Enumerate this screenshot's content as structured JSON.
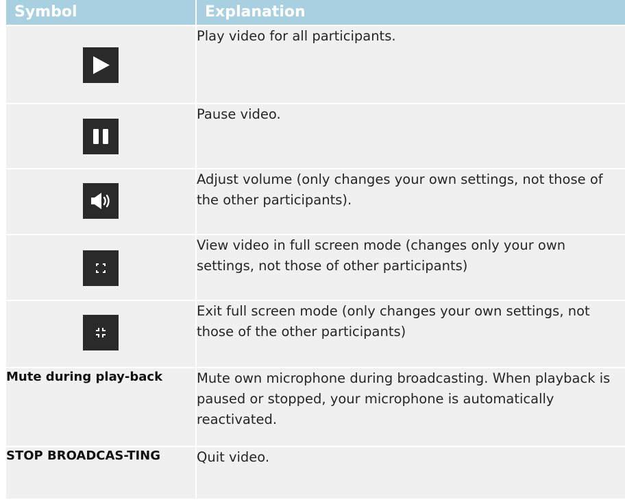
{
  "table": {
    "headers": {
      "symbol": "Symbol",
      "explanation": "Explanation"
    },
    "rows": [
      {
        "symbol_icon": "play-icon",
        "explanation": "Play video for all participants."
      },
      {
        "symbol_icon": "pause-icon",
        "explanation": "Pause video."
      },
      {
        "symbol_icon": "volume-icon",
        "explanation": "Adjust volume (only changes your own settings, not those of the other participants)."
      },
      {
        "symbol_icon": "fullscreen-enter-icon",
        "explanation": "View video in full screen mode (changes only your own settings, not those of other participants)"
      },
      {
        "symbol_icon": "fullscreen-exit-icon",
        "explanation": "Exit full screen mode (only changes your own settings, not those of the other participants)"
      },
      {
        "symbol_label": "Mute during play-back",
        "explanation": "Mute own microphone during broadcasting. When playback is paused or stopped, your microphone is automatically reactivated."
      },
      {
        "symbol_label": "STOP BROADCAS-TING",
        "explanation": "Quit video."
      }
    ]
  },
  "colors": {
    "header_bg": "#a9d0e0",
    "row_bg": "#f0f0f0",
    "icon_tile": "#2a2a2a"
  }
}
